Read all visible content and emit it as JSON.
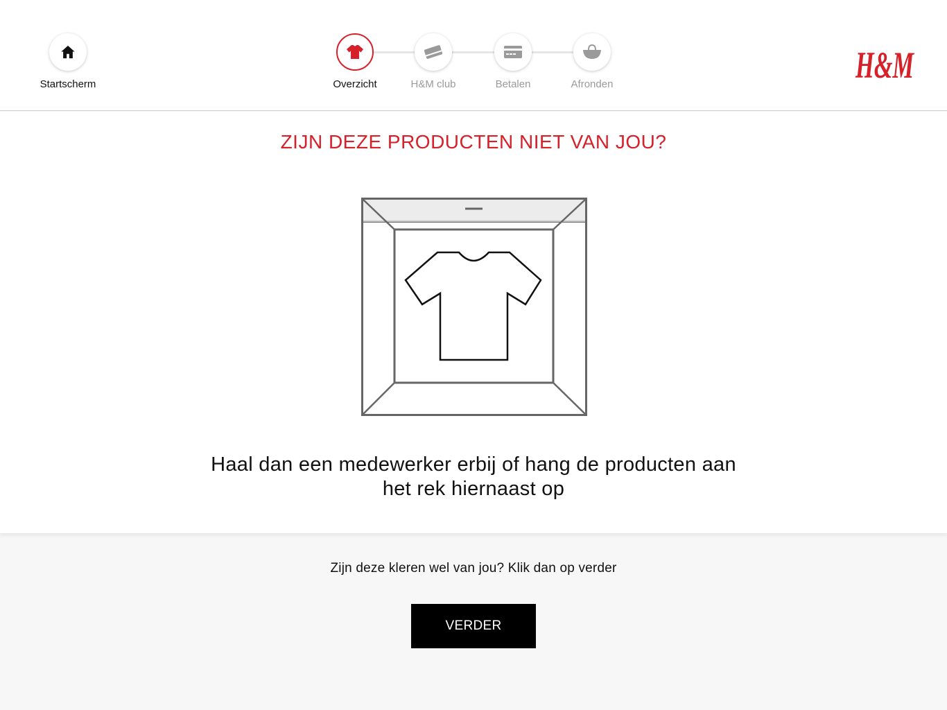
{
  "header": {
    "home": {
      "label": "Startscherm",
      "icon": "home-icon"
    },
    "steps": [
      {
        "label": "Overzicht",
        "icon": "tshirt-icon",
        "state": "active"
      },
      {
        "label": "H&M club",
        "icon": "member-card-icon",
        "state": "upcoming"
      },
      {
        "label": "Betalen",
        "icon": "payment-card-icon",
        "state": "upcoming"
      },
      {
        "label": "Afronden",
        "icon": "shopping-bag-icon",
        "state": "upcoming"
      }
    ],
    "logo_text": "H&M"
  },
  "main": {
    "title": "ZIJN DEZE PRODUCTEN NIET VAN JOU?",
    "illustration_icon": "tshirt-in-box-icon",
    "message_line1": "Haal dan een medewerker erbij of hang de producten aan",
    "message_line2": "het rek hiernaast op"
  },
  "footer": {
    "hint": "Zijn deze kleren wel van jou? Klik dan op verder",
    "button_label": "VERDER"
  },
  "colors": {
    "accent": "#d6202a",
    "text": "#111111",
    "inactive": "#9a9a9a",
    "button": "#000000",
    "background": "#f7f7f7"
  }
}
